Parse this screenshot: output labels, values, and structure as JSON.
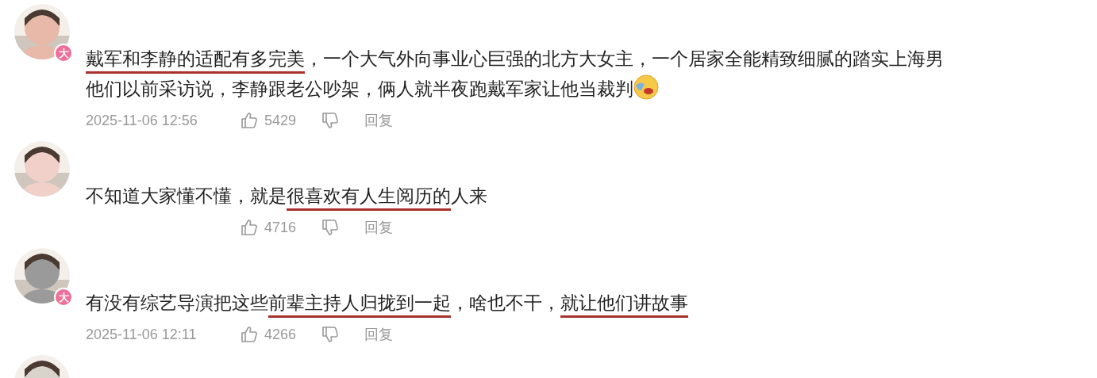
{
  "comments": [
    {
      "avatar": {
        "kind": "picture"
      },
      "badge": "大",
      "lines": [
        [
          {
            "kind": "text",
            "text": "戴军和李静的适配有多完美",
            "underlined": true
          },
          {
            "kind": "text",
            "text": "，一个大气外向事业心巨强的北方大女主，一个居家全能精致细腻的踏实上海男",
            "underlined": false
          }
        ],
        [
          {
            "kind": "text",
            "text": "他们以前采访说，李静跟老公吵架，俩人就半夜跑戴军家让他当裁判",
            "underlined": false
          },
          {
            "kind": "emoji"
          }
        ]
      ],
      "date": "2025-11-06 12:56",
      "likes": "5429",
      "reply": "回复"
    },
    {
      "avatar": {
        "kind": "picture"
      },
      "lines": [
        [
          {
            "kind": "text",
            "text": "不知道大家懂不懂，就是",
            "underlined": false
          },
          {
            "kind": "text",
            "text": "很喜欢有人生阅历的",
            "underlined": true
          },
          {
            "kind": "text",
            "text": "人来",
            "underlined": false
          }
        ]
      ],
      "likes": "4716",
      "reply": "回复"
    },
    {
      "avatar": {
        "kind": "picture"
      },
      "badge": "大",
      "lines": [
        [
          {
            "kind": "text",
            "text": "有没有综艺导演把这些",
            "underlined": false
          },
          {
            "kind": "text",
            "text": "前辈主持人归拢到一起",
            "underlined": true
          },
          {
            "kind": "text",
            "text": "，啥也不干，",
            "underlined": false
          },
          {
            "kind": "text",
            "text": "就让他们讲故事",
            "underlined": true
          }
        ]
      ],
      "date": "2025-11-06 12:11",
      "likes": "4266",
      "reply": "回复"
    },
    {
      "avatar": {
        "kind": "picture"
      }
    }
  ]
}
